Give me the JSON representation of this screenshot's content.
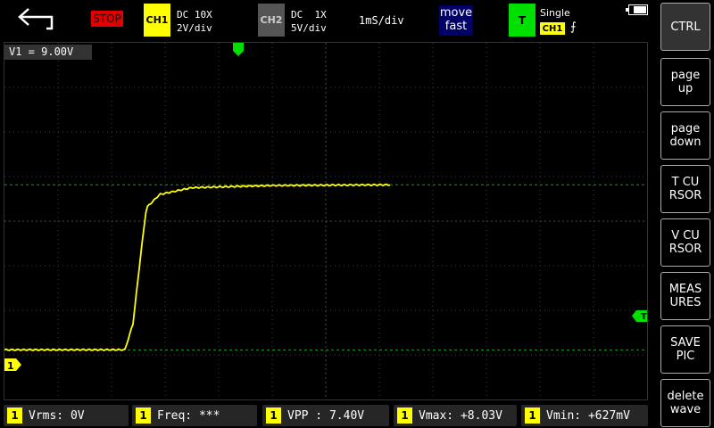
{
  "topbar": {
    "run_state": "STOP",
    "ch1": {
      "badge": "CH1",
      "coupling": "DC 10X",
      "scale": "2V/div"
    },
    "ch2": {
      "badge": "CH2",
      "coupling": "DC  1X",
      "scale": "5V/div"
    },
    "timebase": "1mS/div",
    "mode": {
      "line1": "move",
      "line2": "fast"
    },
    "trigger": {
      "badge": "T",
      "mode": "Single",
      "source": "CH1",
      "edge": "⨍"
    }
  },
  "screen": {
    "cursor_label": "V1 = 9.00V",
    "ch1_marker": "1",
    "trigger_marker": "T"
  },
  "sidebar": {
    "items": [
      {
        "label": "CTRL"
      },
      {
        "label": "page\nup"
      },
      {
        "label": "page\ndown"
      },
      {
        "label": "T CU\nRSOR"
      },
      {
        "label": "V CU\nRSOR"
      },
      {
        "label": "MEAS\nURES"
      },
      {
        "label": "SAVE\nPIC"
      },
      {
        "label": "delete\nwave"
      }
    ]
  },
  "measurements": [
    {
      "ch": "1",
      "text": "Vrms: 0V"
    },
    {
      "ch": "1",
      "text": "Freq: ***"
    },
    {
      "ch": "1",
      "text": "VPP : 7.40V"
    },
    {
      "ch": "1",
      "text": "Vmax: +8.03V"
    },
    {
      "ch": "1",
      "text": "Vmin: +627mV"
    }
  ],
  "colors": {
    "ch1": "#ffff00",
    "trigger": "#00e000",
    "stop": "#e00000",
    "grid": "#3a3a3a"
  },
  "waveform": {
    "trace_desc": "rising step",
    "samples": [
      [
        0,
        0.627
      ],
      [
        2.25,
        0.63
      ],
      [
        2.4,
        1.8
      ],
      [
        2.55,
        5.0
      ],
      [
        2.65,
        7.0
      ],
      [
        2.9,
        7.6
      ],
      [
        3.5,
        7.9
      ],
      [
        5,
        8.0
      ],
      [
        7.2,
        8.03
      ]
    ]
  }
}
